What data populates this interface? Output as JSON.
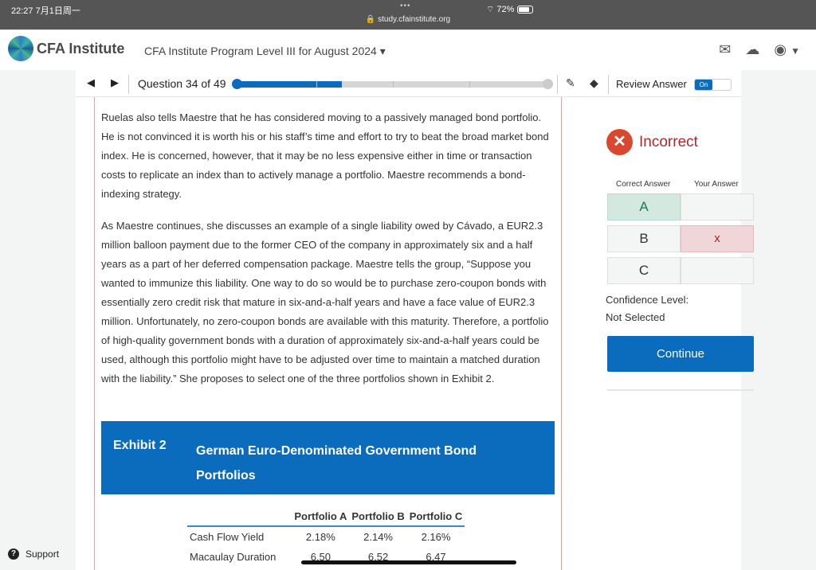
{
  "status_bar": {
    "time": "22:27  7月1日周一",
    "url": "study.cfainstitute.org",
    "battery": "72%"
  },
  "header": {
    "logo": "CFA Institute",
    "program": "CFA Institute Program Level III for August 2024"
  },
  "nav": {
    "question": "Question 34 of 49",
    "progress_fraction": 0.34,
    "review_label": "Review Answer",
    "toggle": "On"
  },
  "passage": [
    "Ruelas also tells Maestre that he has considered moving to a passively managed bond portfolio. He is not convinced it is worth his or his staff’s time and effort to try to beat the broad market bond index. He is concerned, however, that it may be no less expensive either in time or transaction costs to replicate an index than to actively manage a portfolio. Maestre recommends a bond-indexing strategy.",
    "As Maestre continues, she discusses an example of a single liability owed by Cávado, a EUR2.3 million balloon payment due to the former CEO of the company in approximately six and a half years as a part of her deferred compensation package. Maestre tells the group, “Suppose you wanted to immunize this liability. One way to do so would be to purchase zero-coupon bonds with essentially zero credit risk that mature in six-and-a-half years and have a face value of EUR2.3 million. Unfortunately, no zero-coupon bonds are available with this maturity. Therefore, a portfolio of high-quality government bonds with a duration of approximately six-and-a-half years could be used, although this portfolio might have to be adjusted over time to maintain a matched duration with the liability.” She proposes to select one of the three portfolios shown in Exhibit 2."
  ],
  "exhibit": {
    "number": "Exhibit 2",
    "title": "German Euro-Denominated Government Bond Portfolios",
    "headers": [
      "",
      "Portfolio A",
      "Portfolio B",
      "Portfolio C"
    ],
    "rows": [
      [
        "Cash Flow Yield",
        "2.18%",
        "2.14%",
        "2.16%"
      ],
      [
        "Macaulay Duration",
        "6.50",
        "6.52",
        "6.47"
      ]
    ]
  },
  "result": {
    "status": "Incorrect",
    "correct_header": "Correct Answer",
    "your_header": "Your Answer",
    "options": [
      {
        "label": "A",
        "your": ""
      },
      {
        "label": "B",
        "your": "x"
      },
      {
        "label": "C",
        "your": ""
      }
    ],
    "correct": "A",
    "selected": "B",
    "confidence_label": "Confidence Level:",
    "confidence_value": "Not Selected",
    "continue": "Continue"
  },
  "support": "Support",
  "colors": {
    "accent": "#0b6bbd",
    "correct_bg": "#d3e9e0",
    "wrong_bg": "#f0d6d8",
    "incorrect": "#b3262b"
  }
}
